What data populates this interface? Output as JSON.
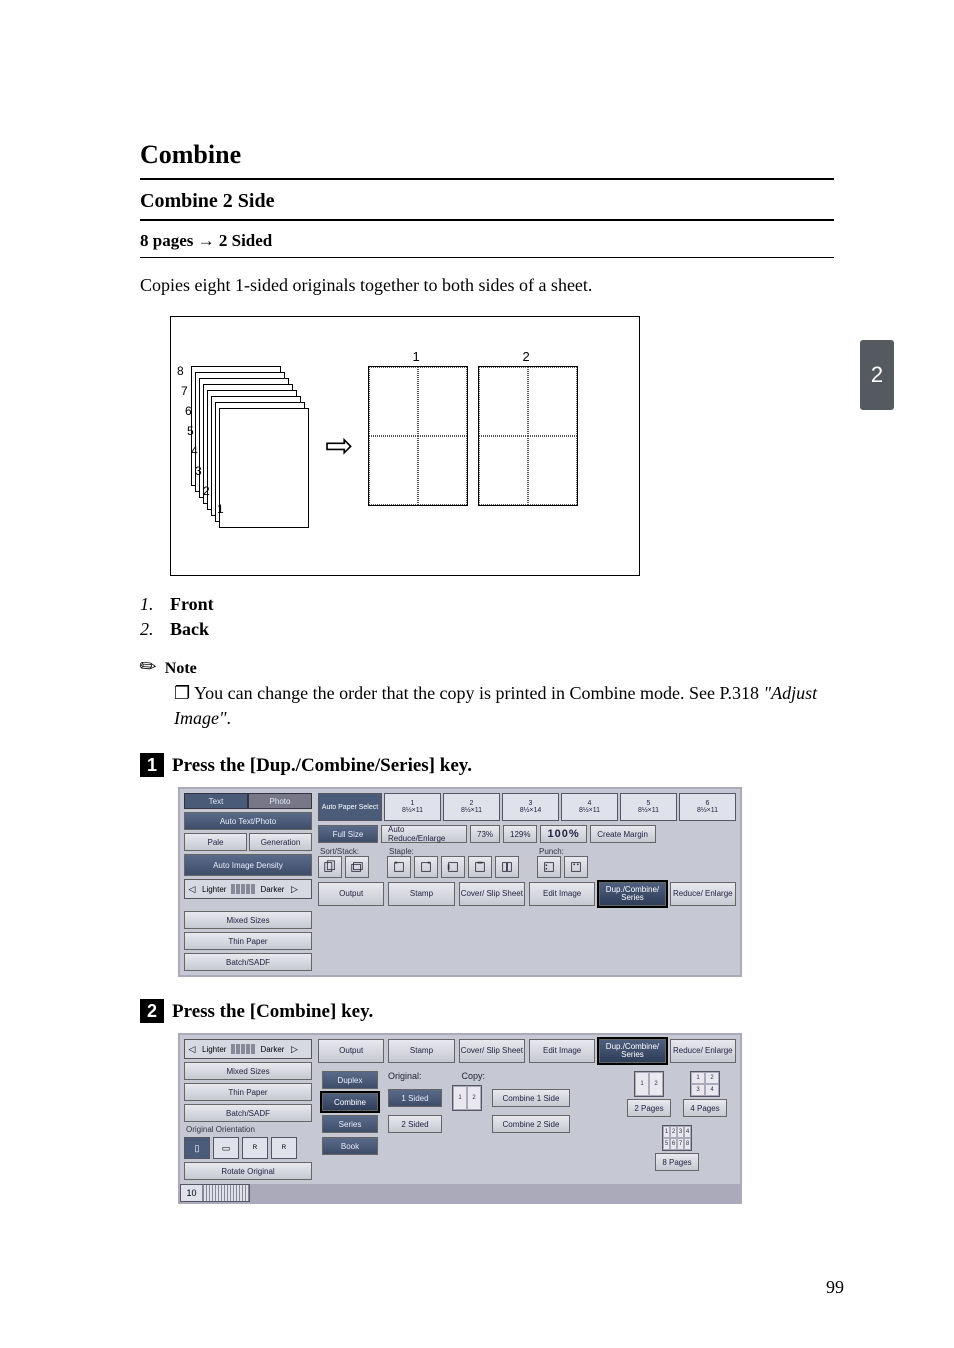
{
  "section_title": "Combine",
  "sub_title": "Combine 2 Side",
  "sub_sub": "8 pages → 2 Sided",
  "intro": "Copies eight 1-sided originals together to both sides of a sheet.",
  "diagram": {
    "stack_labels": [
      "8",
      "7",
      "6",
      "5",
      "4",
      "3",
      "2",
      "1"
    ],
    "page_front": "1",
    "page_back": "2"
  },
  "list": [
    {
      "n": "1.",
      "label": "Front"
    },
    {
      "n": "2.",
      "label": "Back"
    }
  ],
  "note_heading": "Note",
  "note_line1": "You can change the order that the copy is printed in Combine mode. See P.318 ",
  "note_italic": "\"Adjust Image\"",
  "note_tail": ".",
  "step1_prefix": "Press the ",
  "step1_key": "[Dup./Combine/Series]",
  "step1_suffix": " key.",
  "step2_prefix": "Press the ",
  "step2_key": "[Combine]",
  "step2_suffix": " key.",
  "panel1": {
    "tabs": [
      "Text",
      "Photo"
    ],
    "auto_textphoto": "Auto Text/Photo",
    "pale": "Pale",
    "generation": "Generation",
    "auto_density": "Auto Image Density",
    "lighter": "Lighter",
    "darker": "Darker",
    "mixed_sizes": "Mixed Sizes",
    "thin_paper": "Thin Paper",
    "batch": "Batch/SADF",
    "paper_select": "Auto Paper Select",
    "trays": [
      {
        "num": "1",
        "size": "8½×11"
      },
      {
        "num": "2",
        "size": "8½×11"
      },
      {
        "num": "3",
        "size": "8½×14"
      },
      {
        "num": "4",
        "size": "8½×11"
      },
      {
        "num": "5",
        "size": "8½×11"
      },
      {
        "num": "6",
        "size": "8½×11"
      }
    ],
    "full_size": "Full Size",
    "auto_re": "Auto Reduce/Enlarge",
    "r1": "73%",
    "r2": "129%",
    "r_big": "100%",
    "create_margin": "Create Margin",
    "sort_stack": "Sort/Stack:",
    "staple": "Staple:",
    "punch": "Punch:",
    "funcs": [
      "Output",
      "Stamp",
      "Cover/\nSlip Sheet",
      "Edit Image",
      "Dup./Combine/\nSeries",
      "Reduce/\nEnlarge"
    ]
  },
  "panel2": {
    "lighter": "Lighter",
    "darker": "Darker",
    "mixed_sizes": "Mixed Sizes",
    "thin_paper": "Thin Paper",
    "batch": "Batch/SADF",
    "orig_orient": "Original Orientation",
    "rotate": "Rotate Original",
    "tab_count": "10",
    "funcs": [
      "Output",
      "Stamp",
      "Cover/\nSlip Sheet",
      "Edit Image",
      "Dup./Combine/\nSeries",
      "Reduce/\nEnlarge"
    ],
    "side_btns": [
      "Duplex",
      "Combine",
      "Series",
      "Book"
    ],
    "original_label": "Original:",
    "copy_label": "Copy:",
    "one_sided": "1 Sided",
    "two_sided": "2 Sided",
    "comb1": "Combine 1 Side",
    "comb2": "Combine 2 Side",
    "p2": "2 Pages",
    "p4": "4 Pages",
    "p8": "8 Pages"
  },
  "page_number": "99",
  "side_tab": "2"
}
